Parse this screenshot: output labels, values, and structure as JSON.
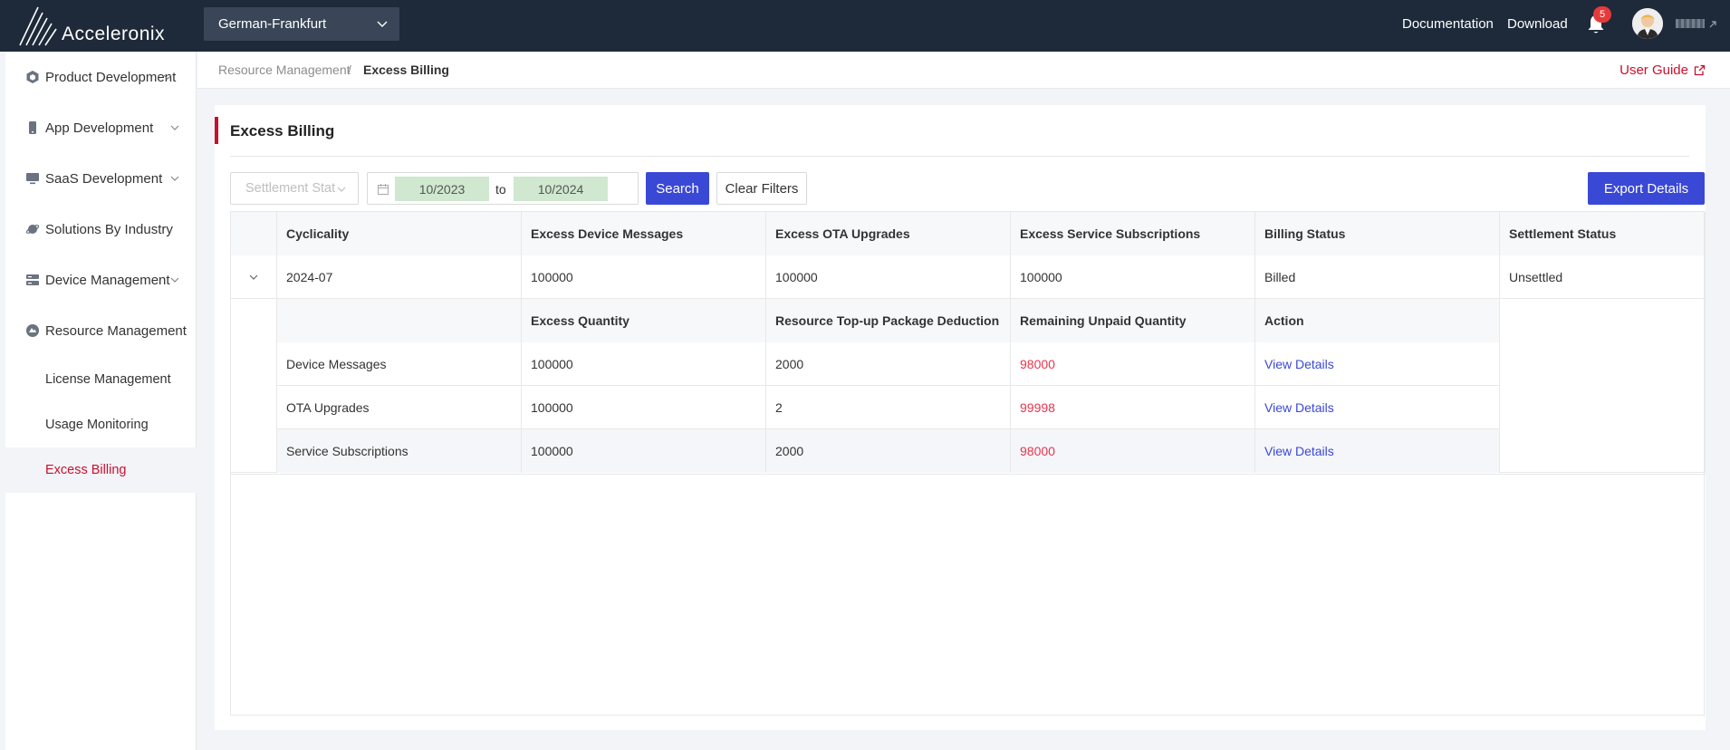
{
  "header": {
    "brand": "Acceleronix",
    "region": "German-Frankfurt",
    "links": {
      "documentation": "Documentation",
      "download": "Download"
    },
    "notification_count": "5"
  },
  "sidebar": {
    "items": [
      {
        "label": "Product Development",
        "icon": "cube-icon",
        "has_caret": true
      },
      {
        "label": "App Development",
        "icon": "phone-icon",
        "has_caret": true
      },
      {
        "label": "SaaS Development",
        "icon": "monitor-icon",
        "has_caret": true
      },
      {
        "label": "Solutions By Industry",
        "icon": "planet-icon",
        "has_caret": false
      },
      {
        "label": "Device Management",
        "icon": "server-icon",
        "has_caret": true
      },
      {
        "label": "Resource Management",
        "icon": "resource-icon",
        "has_caret": false
      }
    ],
    "sub_items": [
      {
        "label": "License Management",
        "active": false
      },
      {
        "label": "Usage Monitoring",
        "active": false
      },
      {
        "label": "Excess Billing",
        "active": true
      }
    ]
  },
  "breadcrumb": {
    "parent": "Resource Management",
    "separator": "/",
    "current": "Excess Billing"
  },
  "user_guide": "User Guide",
  "card": {
    "title": "Excess Billing",
    "filters": {
      "settlement_placeholder": "Settlement Stat",
      "date_from": "10/2023",
      "date_to_label": "to",
      "date_to": "10/2024",
      "search": "Search",
      "clear": "Clear Filters",
      "export": "Export Details"
    },
    "table": {
      "columns": [
        "Cyclicality",
        "Excess Device Messages",
        "Excess OTA Upgrades",
        "Excess Service Subscriptions",
        "Billing Status",
        "Settlement Status"
      ],
      "row": {
        "cycle": "2024-07",
        "device_messages": "100000",
        "ota_upgrades": "100000",
        "service_subscriptions": "100000",
        "billing_status": "Billed",
        "settlement_status": "Unsettled"
      },
      "sub_columns": [
        "Excess Quantity",
        "Resource Top-up Package Deduction",
        "Remaining Unpaid Quantity",
        "Action"
      ],
      "sub_rows": [
        {
          "name": "Device Messages",
          "excess": "100000",
          "deduction": "2000",
          "remaining": "98000",
          "action": "View Details"
        },
        {
          "name": "OTA Upgrades",
          "excess": "100000",
          "deduction": "2",
          "remaining": "99998",
          "action": "View Details"
        },
        {
          "name": "Service Subscriptions",
          "excess": "100000",
          "deduction": "2000",
          "remaining": "98000",
          "action": "View Details"
        }
      ]
    }
  },
  "colors": {
    "accent_red": "#c8102e",
    "primary_blue": "#3a48d6",
    "topbar": "#1e2a3a",
    "remaining_red": "#e8344e"
  }
}
